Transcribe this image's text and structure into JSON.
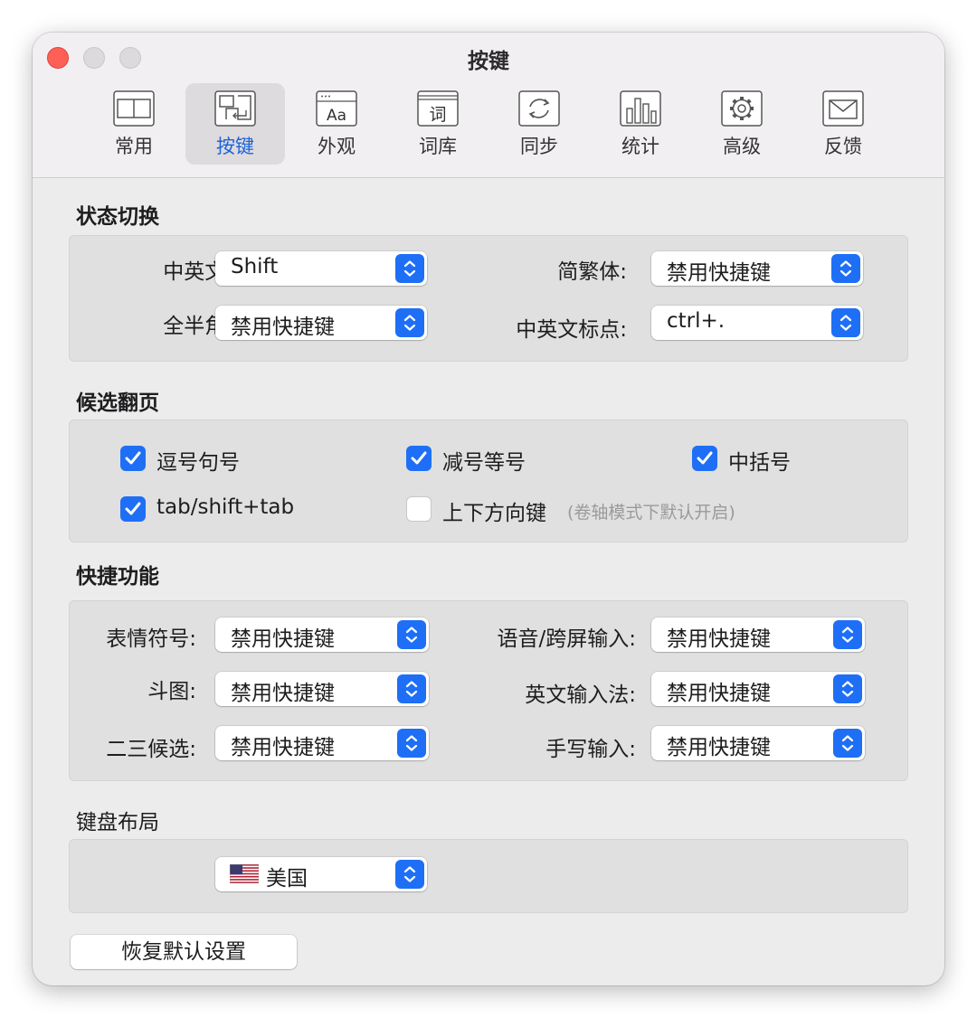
{
  "window": {
    "title": "按键"
  },
  "toolbar": {
    "tabs": [
      {
        "label": "常用",
        "icon": "general-icon"
      },
      {
        "label": "按键",
        "icon": "keys-icon",
        "active": true
      },
      {
        "label": "外观",
        "icon": "appearance-icon"
      },
      {
        "label": "词库",
        "icon": "dictionary-icon"
      },
      {
        "label": "同步",
        "icon": "sync-icon"
      },
      {
        "label": "统计",
        "icon": "statistics-icon"
      },
      {
        "label": "高级",
        "icon": "gear-icon"
      },
      {
        "label": "反馈",
        "icon": "mail-icon"
      }
    ]
  },
  "state_switch": {
    "title": "状态切换",
    "cn_en": {
      "label": "中英文:",
      "value": "Shift"
    },
    "simp_trad": {
      "label": "简繁体:",
      "value": "禁用快捷键"
    },
    "full_half": {
      "label": "全半角:",
      "value": "禁用快捷键"
    },
    "punctuation": {
      "label": "中英文标点:",
      "value": "ctrl+."
    }
  },
  "paging": {
    "title": "候选翻页",
    "comma_period": {
      "label": "逗号句号",
      "checked": true
    },
    "minus_equal": {
      "label": "减号等号",
      "checked": true
    },
    "brackets": {
      "label": "中括号",
      "checked": true
    },
    "tab_shift_tab": {
      "label": "tab/shift+tab",
      "checked": true
    },
    "arrow_keys": {
      "label": "上下方向键",
      "hint": "(卷轴模式下默认开启)",
      "checked": false
    }
  },
  "shortcuts": {
    "title": "快捷功能",
    "emoji": {
      "label": "表情符号:",
      "value": "禁用快捷键"
    },
    "voice": {
      "label": "语音/跨屏输入:",
      "value": "禁用快捷键"
    },
    "doutu": {
      "label": "斗图:",
      "value": "禁用快捷键"
    },
    "english_ime": {
      "label": "英文输入法:",
      "value": "禁用快捷键"
    },
    "second_third": {
      "label": "二三候选:",
      "value": "禁用快捷键"
    },
    "handwriting": {
      "label": "手写输入:",
      "value": "禁用快捷键"
    }
  },
  "keyboard_layout": {
    "title": "键盘布局",
    "value": "美国",
    "flag_icon": "us-flag-icon"
  },
  "restore_button": "恢复默认设置",
  "colors": {
    "accent": "#1e6ff5",
    "close": "#fe5f57",
    "active_tab_text": "#1b63d8"
  }
}
